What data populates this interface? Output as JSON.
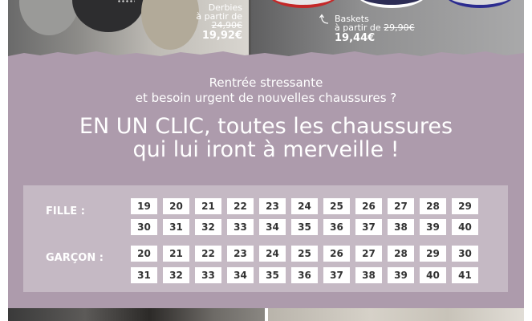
{
  "products": [
    {
      "name": "Derbies",
      "from_label": "à partir de",
      "old_price": "24,90€",
      "price": "19,92€"
    },
    {
      "name": "Baskets",
      "from_label": "à partir de",
      "old_price": "29,90€",
      "price": "19,44€"
    }
  ],
  "intro": {
    "line1": "Rentrée stressante",
    "line2": "et besoin urgent de nouvelles chaussures ?"
  },
  "headline": {
    "line1": "EN UN CLIC, toutes les chaussures",
    "line2": "qui lui iront à merveille !"
  },
  "sizes": {
    "girl_label": "FILLE :",
    "boy_label": "GARÇON :",
    "girl_rows": [
      [
        "19",
        "20",
        "21",
        "22",
        "23",
        "24",
        "25",
        "26",
        "27",
        "28",
        "29"
      ],
      [
        "30",
        "31",
        "32",
        "33",
        "34",
        "35",
        "36",
        "37",
        "38",
        "39",
        "40"
      ]
    ],
    "boy_rows": [
      [
        "20",
        "21",
        "22",
        "23",
        "24",
        "25",
        "26",
        "27",
        "28",
        "29",
        "30"
      ],
      [
        "31",
        "32",
        "33",
        "34",
        "35",
        "36",
        "37",
        "38",
        "39",
        "40",
        "41"
      ]
    ]
  },
  "colors": {
    "mauve": "#ad9bac",
    "grid_panel": "#c5b9c4",
    "button_bg": "#ffffff",
    "text_light": "#ffffff"
  }
}
